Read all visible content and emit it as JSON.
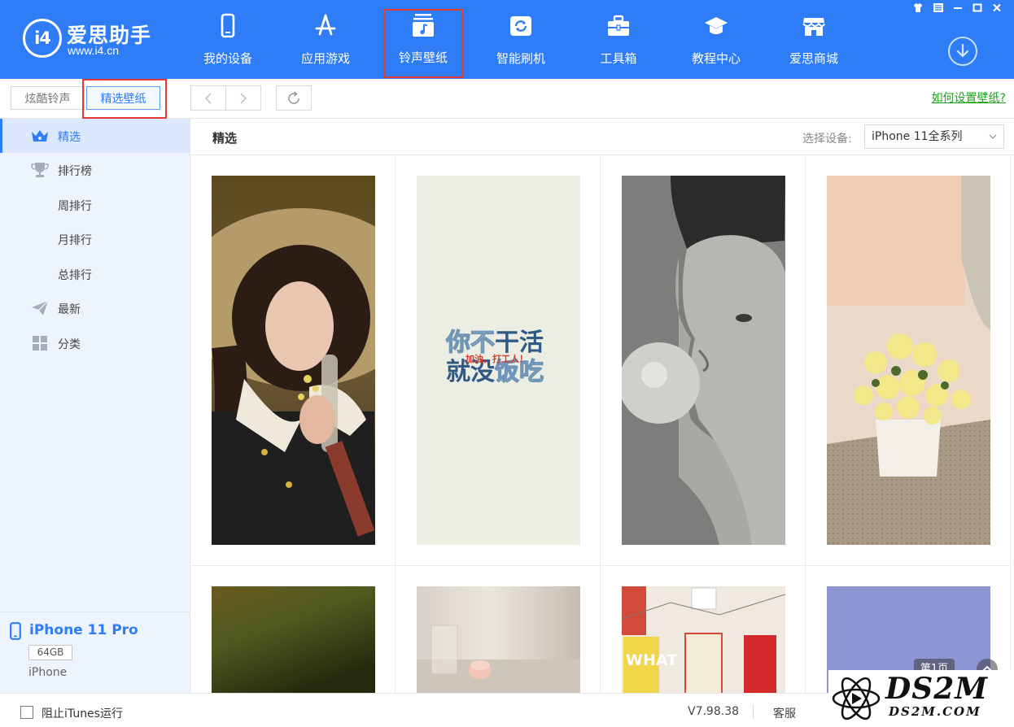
{
  "app": {
    "brand_name": "爱思助手",
    "brand_url": "www.i4.cn",
    "logo_text": "i4"
  },
  "colors": {
    "primary": "#2E7CF6",
    "highlight_box": "#E53935",
    "link_green": "#1aa31a",
    "sidebar_bg": "#eef4fd"
  },
  "nav": {
    "items": [
      {
        "label": "我的设备",
        "icon": "phone-icon"
      },
      {
        "label": "应用游戏",
        "icon": "app-store-icon"
      },
      {
        "label": "铃声壁纸",
        "icon": "music-note-icon",
        "active": true
      },
      {
        "label": "智能刷机",
        "icon": "refresh-box-icon"
      },
      {
        "label": "工具箱",
        "icon": "toolbox-icon"
      },
      {
        "label": "教程中心",
        "icon": "graduation-cap-icon"
      },
      {
        "label": "爱思商城",
        "icon": "store-icon"
      }
    ]
  },
  "window_controls": [
    "shirt-icon",
    "list-icon",
    "minimize-icon",
    "maximize-icon",
    "close-icon"
  ],
  "subbar": {
    "tab_ringtones": "炫酷铃声",
    "tab_wallpapers": "精选壁纸",
    "howto_link": "如何设置壁纸?"
  },
  "sidebar": {
    "items": [
      {
        "label": "精选",
        "icon": "crown-icon",
        "active": true
      },
      {
        "label": "排行榜",
        "icon": "trophy-icon"
      },
      {
        "label": "周排行"
      },
      {
        "label": "月排行"
      },
      {
        "label": "总排行"
      },
      {
        "label": "最新",
        "icon": "paper-plane-icon"
      },
      {
        "label": "分类",
        "icon": "grid-icon"
      }
    ]
  },
  "device": {
    "name": "iPhone 11 Pro",
    "capacity": "64GB",
    "type": "iPhone"
  },
  "main": {
    "title": "精选",
    "device_label": "选择设备:",
    "device_select": "iPhone 11全系列",
    "wallpapers": [
      {
        "name": "wallpaper-girl-hat"
      },
      {
        "name": "wallpaper-text-poster",
        "text_line1a": "你不",
        "text_line1b": "干活",
        "text_line2a": "就没",
        "text_line2b": "饭吃",
        "text_small": "加油，打工人！"
      },
      {
        "name": "wallpaper-bubblegum-man"
      },
      {
        "name": "wallpaper-lily-flowers"
      },
      {
        "name": "wallpaper-dark-green"
      },
      {
        "name": "wallpaper-glass-candle"
      },
      {
        "name": "wallpaper-poster-wall",
        "text_what": "WHAT"
      },
      {
        "name": "wallpaper-lavender"
      }
    ],
    "page_indicator": "第1页"
  },
  "status": {
    "block_itunes_label": "阻止iTunes运行",
    "version": "V7.98.38",
    "service": "客服"
  },
  "watermark": {
    "main": "DS2M",
    "sub": "DS2M.COM"
  }
}
